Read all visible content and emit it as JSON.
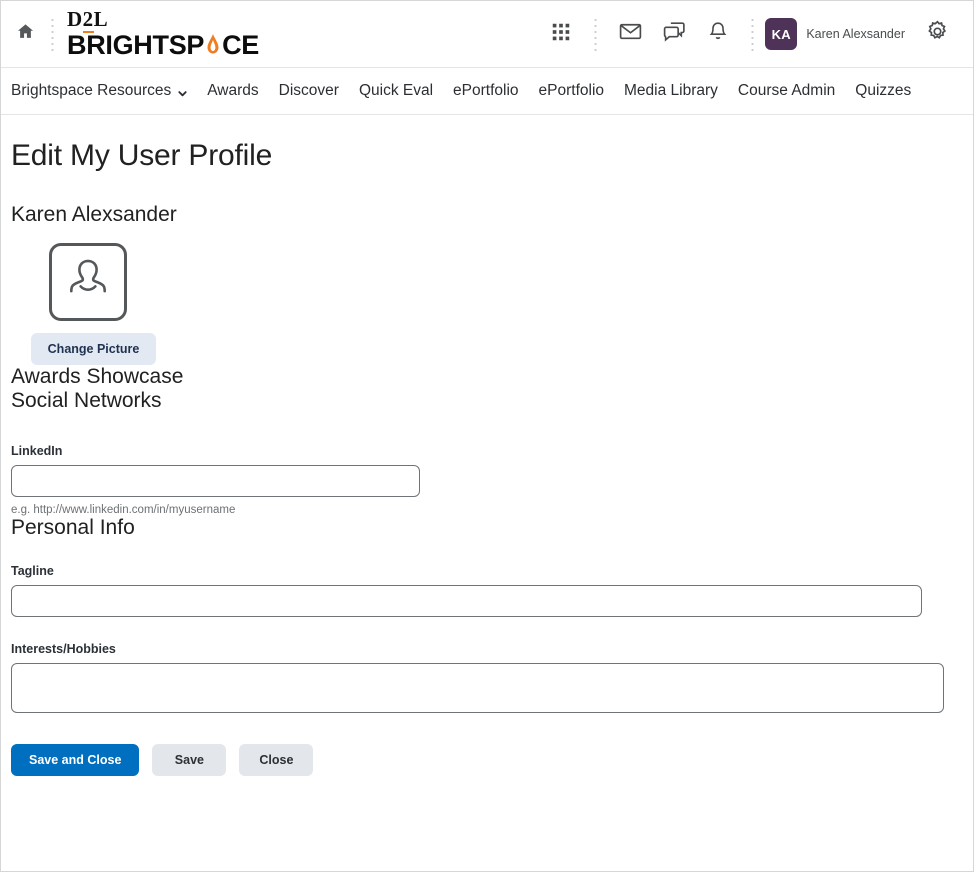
{
  "header": {
    "home_icon": "home-icon",
    "brand_line1": "D2L",
    "brand_line1_accent": "2",
    "brand_line2_pre": "BRIGHTSP",
    "brand_line2_accent": "A",
    "brand_line2_post": "CE",
    "icons": [
      {
        "name": "apps-grid-icon",
        "label": "Course Selector"
      },
      {
        "name": "envelope-icon",
        "label": "Email"
      },
      {
        "name": "chat-bubble-icon",
        "label": "Subscription Alerts"
      },
      {
        "name": "bell-icon",
        "label": "Update Alerts"
      }
    ],
    "avatar_initials": "KA",
    "user_name": "Karen Alexsander",
    "settings_icon": "gear-icon",
    "avatar_color": "#4e3257",
    "accent_color": "#ef7d22"
  },
  "nav": {
    "items": [
      {
        "label": "Brightspace Resources",
        "has_chevron": true
      },
      {
        "label": "Awards",
        "has_chevron": false
      },
      {
        "label": "Discover",
        "has_chevron": false
      },
      {
        "label": "Quick Eval",
        "has_chevron": false
      },
      {
        "label": "ePortfolio",
        "has_chevron": false
      },
      {
        "label": "ePortfolio",
        "has_chevron": false
      },
      {
        "label": "Media Library",
        "has_chevron": false
      },
      {
        "label": "Course Admin",
        "has_chevron": false
      },
      {
        "label": "Quizzes",
        "has_chevron": false
      }
    ]
  },
  "main": {
    "page_title": "Edit My User Profile",
    "person_name": "Karen Alexsander",
    "avatar": {
      "placeholder_icon": "person-silhouette-icon",
      "change_picture_label": "Change Picture"
    },
    "awards_showcase_title": "Awards Showcase",
    "social_networks_title": "Social Networks",
    "linkedin": {
      "label": "LinkedIn",
      "value": "",
      "placeholder": "",
      "hint": "e.g. http://www.linkedin.com/in/myusername"
    },
    "personal_info_title": "Personal Info",
    "tagline": {
      "label": "Tagline",
      "value": "",
      "placeholder": ""
    },
    "interests": {
      "label": "Interests/Hobbies",
      "value": "",
      "placeholder": ""
    }
  },
  "actions": {
    "save_and_close_label": "Save and Close",
    "save_label": "Save",
    "close_label": "Close",
    "primary_color": "#006fbf",
    "secondary_color": "#e3e6ea"
  }
}
